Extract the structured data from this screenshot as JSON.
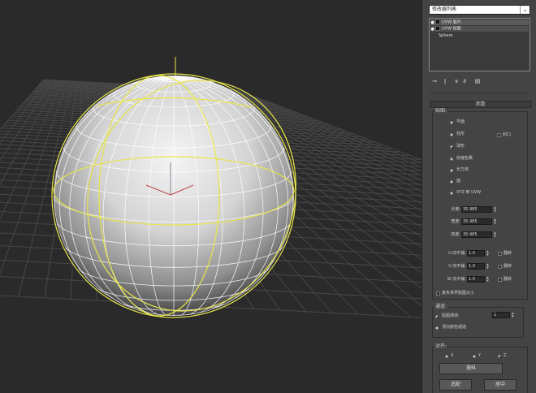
{
  "viewport": {
    "label": "perspective viewport"
  },
  "modifier_list": {
    "value": "修改器列表"
  },
  "stack": {
    "items": [
      {
        "label": "UVW 展开"
      },
      {
        "label": "UVW 贴图"
      },
      {
        "label": "Sphere"
      }
    ]
  },
  "toolbar": {
    "icons": [
      "pin-stack-icon",
      "show-end-result-icon",
      "make-unique-icon",
      "remove-modifier-icon",
      "configure-sets-icon"
    ]
  },
  "params": {
    "title": "参数",
    "mapping": {
      "title": "贴图:",
      "options": [
        "平面",
        "柱形",
        "球形",
        "收缩包裹",
        "长方体",
        "面",
        "XYZ 到 UVW"
      ],
      "selected": "球形",
      "cap_label": "封口"
    },
    "size": {
      "length_label": "长度:",
      "length": "35.985",
      "width_label": "宽度:",
      "width": "35.985",
      "height_label": "高度:",
      "height": "35.985"
    },
    "tile": {
      "u_label": "U 向平铺:",
      "u": "1.0",
      "v_label": "V 向平铺:",
      "v": "1.0",
      "w_label": "W 向平铺:",
      "w": "1.0",
      "flip_label": "翻转"
    },
    "real_world_label": "真实世界贴图大小",
    "channel": {
      "title": "通道:",
      "map_channel_label": "贴图通道:",
      "map_channel": "1",
      "vertex_color_label": "顶点颜色通道"
    },
    "alignment": {
      "title": "对齐:",
      "x": "X",
      "y": "Y",
      "z": "Z",
      "selected": "Z",
      "manipulate_label": "操纵",
      "fit_label": "适配",
      "center_label": "居中"
    }
  },
  "colors": {
    "selection": "#e8e64a",
    "grid": "#4a4a4a",
    "panel": "#444444"
  }
}
